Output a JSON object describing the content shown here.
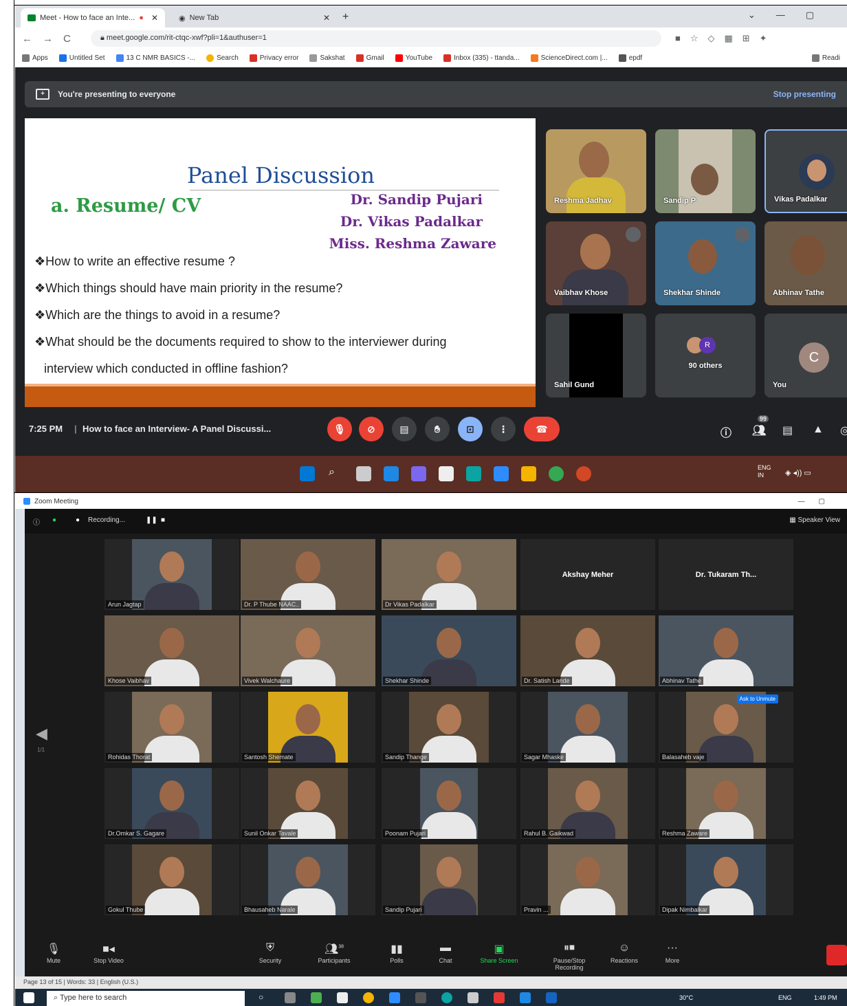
{
  "browser": {
    "tab1": "Meet - How to face an Inte...",
    "tab2": "New Tab",
    "url": "meet.google.com/rit-ctqc-xwf?pli=1&authuser=1",
    "bookmarks": [
      "Apps",
      "Untitled Set",
      "13 C NMR BASICS -...",
      "Search",
      "Privacy error",
      "Sakshat",
      "Gmail",
      "YouTube",
      "Inbox (335) - ttanda...",
      "ScienceDirect.com |...",
      "epdf",
      "Readi"
    ]
  },
  "meet": {
    "presenting": "You're presenting to everyone",
    "stop": "Stop presenting",
    "slide": {
      "title": "Panel Discussion",
      "subtitle": "a. Resume/ CV",
      "panelists": [
        "Dr. Sandip Pujari",
        "Dr. Vikas Padalkar",
        "Miss. Reshma Zaware"
      ],
      "questions": [
        "❖How to write an effective resume ?",
        "❖Which things should have main priority in the resume?",
        "❖Which are the things to avoid in a resume?",
        "❖What should be the documents required to show to the interviewer during",
        "interview which conducted in offline fashion?"
      ]
    },
    "tiles": [
      "Reshma Jadhav",
      "Sandip P",
      "Vikas Padalkar",
      "Vaibhav Khose",
      "Shekhar Shinde",
      "Abhinav Tathe",
      "Sahil Gund",
      "90 others",
      "You"
    ],
    "avatar_c": "C",
    "avatar_r": "R",
    "time": "7:25 PM",
    "meeting_title": "How to face an Interview- A Panel Discussi...",
    "participant_count": "99"
  },
  "zoom": {
    "window_title": "Zoom Meeting",
    "recording": "Recording...",
    "view": "Speaker View",
    "page": "1/1",
    "participants": [
      [
        "Arun Jagtap",
        "Dr. P Thube NAAC..",
        "Dr Vikas Padalkar",
        "Akshay Meher",
        "Dr. Tukaram  Th..."
      ],
      [
        "Khose Vaibhav",
        "Vivek Walchaure",
        "Shekhar Shinde",
        "Dr. Satish Lande",
        "Abhinav Tathe"
      ],
      [
        "Rohidas Thorat",
        "Santosh Shemate",
        "Sandip Thange",
        "Sagar Mhaske",
        "Balasaheb vaje"
      ],
      [
        "Dr.Omkar S. Gagare",
        "Sunil Onkar Tavale",
        "Poonam Pujari",
        "Rahul B. Gaikwad",
        "Reshma Zaware"
      ],
      [
        "Gokul Thube",
        "Bhausaheb Narale",
        "Sandip Pujari",
        "Pravin ...",
        "Dipak Nimbalkar"
      ]
    ],
    "admit": "Ask to Unmute",
    "toolbar": [
      "Mute",
      "Stop Video",
      "Security",
      "Participants",
      "Polls",
      "Chat",
      "Share Screen",
      "Pause/Stop Recording",
      "Reactions",
      "More"
    ],
    "participants_count": "38"
  },
  "status": "Page 13 of 15  |  Words: 33  |  English (U.S.)",
  "search_placeholder": "Type here to search",
  "clock": "1:49 PM",
  "temp": "30°C",
  "lang": "ENG",
  "lang_region": "IN",
  "colors": {
    "meet_bg": "#202124",
    "accent": "#8ab4f8",
    "red": "#ea4335",
    "slide_title": "#1f4e96",
    "slide_green": "#2e9b45",
    "slide_purple": "#6b2a8c",
    "band": "#c55a11"
  }
}
